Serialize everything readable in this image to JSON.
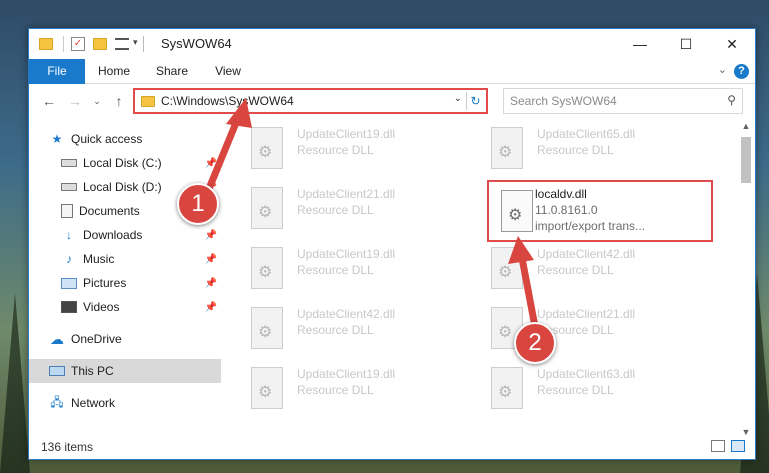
{
  "window": {
    "title": "SysWOW64"
  },
  "ribbon": {
    "tabs": [
      "File",
      "Home",
      "Share",
      "View"
    ],
    "help": "?"
  },
  "nav": {
    "address_path": "C:\\Windows\\SysWOW64",
    "search_placeholder": "Search SysWOW64"
  },
  "sidebar": {
    "items": [
      {
        "label": "Quick access",
        "icon": "star-icon",
        "pinned": false
      },
      {
        "label": "Local Disk (C:)",
        "icon": "drive-icon",
        "pinned": true
      },
      {
        "label": "Local Disk (D:)",
        "icon": "drive-icon",
        "pinned": true
      },
      {
        "label": "Documents",
        "icon": "documents-icon",
        "pinned": true
      },
      {
        "label": "Downloads",
        "icon": "download-icon",
        "pinned": true
      },
      {
        "label": "Music",
        "icon": "music-icon",
        "pinned": true
      },
      {
        "label": "Pictures",
        "icon": "pictures-icon",
        "pinned": true
      },
      {
        "label": "Videos",
        "icon": "videos-icon",
        "pinned": true
      },
      {
        "label": "OneDrive",
        "icon": "cloud-icon",
        "pinned": false
      },
      {
        "label": "This PC",
        "icon": "computer-icon",
        "pinned": false,
        "selected": true
      },
      {
        "label": "Network",
        "icon": "network-icon",
        "pinned": false
      }
    ]
  },
  "files": {
    "left": [
      {
        "name": "UpdateClient19.dll",
        "type": "Resource DLL"
      },
      {
        "name": "UpdateClient21.dll",
        "type": "Resource DLL"
      },
      {
        "name": "UpdateClient19.dll",
        "type": "Resource DLL"
      },
      {
        "name": "UpdateClient42.dll",
        "type": "Resource DLL"
      },
      {
        "name": "UpdateClient19.dll",
        "type": "Resource DLL"
      }
    ],
    "right": [
      {
        "name": "UpdateClient65.dll",
        "type": "Resource DLL"
      },
      {
        "name": "localdv.dll",
        "version": "11.0.8161.0",
        "type": "import/export trans...",
        "focused": true
      },
      {
        "name": "UpdateClient42.dll",
        "type": "Resource DLL"
      },
      {
        "name": "UpdateClient21.dll",
        "type": "Resource DLL"
      },
      {
        "name": "UpdateClient63.dll",
        "type": "Resource DLL"
      }
    ]
  },
  "status": {
    "item_count": "136 items"
  },
  "annotations": [
    "1",
    "2"
  ],
  "colors": {
    "accent": "#1979ca",
    "highlight": "#e04b4b",
    "annotation": "#d9453f"
  }
}
